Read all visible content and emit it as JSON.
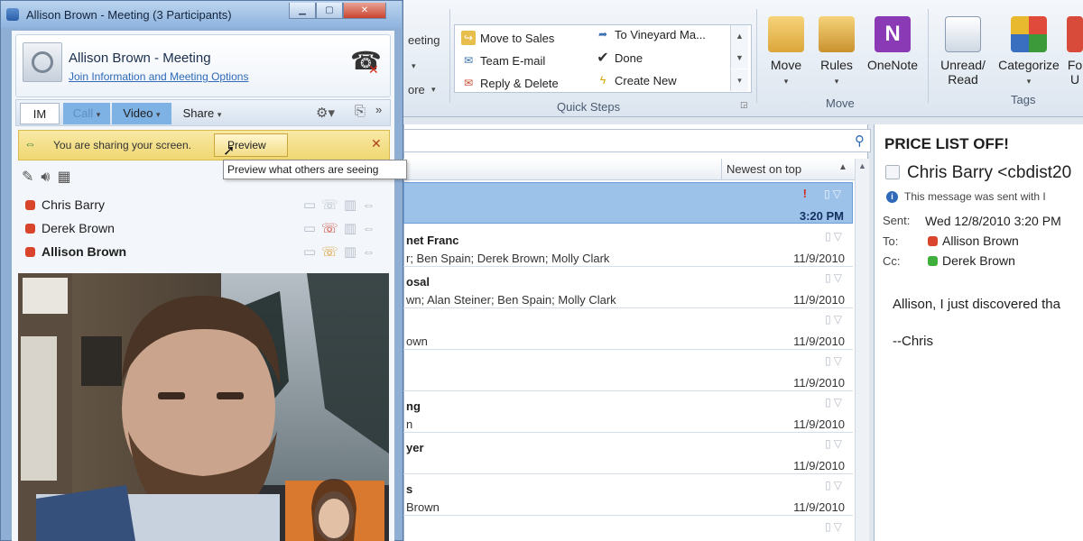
{
  "ribbon": {
    "partial_left": [
      "eeting",
      "ore"
    ],
    "quick_steps": [
      {
        "label": "Move to Sales",
        "icon": "folder-move-icon"
      },
      {
        "label": "Team E-mail",
        "icon": "team-email-icon"
      },
      {
        "label": "Reply & Delete",
        "icon": "reply-delete-icon"
      },
      {
        "label": "To Vineyard Ma...",
        "icon": "forward-icon"
      },
      {
        "label": "Done",
        "icon": "checkmark-icon"
      },
      {
        "label": "Create New",
        "icon": "lightning-icon"
      }
    ],
    "quick_steps_label": "Quick Steps",
    "move_group": {
      "move": "Move",
      "rules": "Rules",
      "onenote": "OneNote",
      "label": "Move"
    },
    "tags_group": {
      "unread_line1": "Unread/",
      "unread_line2": "Read",
      "categorize": "Categorize",
      "follow_partial_1": "Fo",
      "follow_partial_2": "U",
      "label": "Tags"
    }
  },
  "mail_list": {
    "sort_label": "Newest on top",
    "selected_time": "3:20 PM",
    "rows": [
      {
        "sender": "net Franc",
        "recipients": "r;  Ben Spain;  Derek Brown;  Molly Clark",
        "date": "11/9/2010"
      },
      {
        "sender": "osal",
        "recipients": "wn;  Alan Steiner;  Ben Spain;  Molly Clark",
        "date": "11/9/2010"
      },
      {
        "sender": "",
        "recipients": "own",
        "date": "11/9/2010"
      },
      {
        "sender": "",
        "recipients": "",
        "date": "11/9/2010"
      },
      {
        "sender": "ng",
        "recipients": "n",
        "date": "11/9/2010"
      },
      {
        "sender": "yer",
        "recipients": "",
        "date": "11/9/2010"
      },
      {
        "sender": "s",
        "recipients": "Brown",
        "date": "11/9/2010"
      }
    ]
  },
  "reading": {
    "subject": "PRICE LIST OFF!",
    "from": "Chris Barry <cbdist20",
    "info": "This message was sent with I",
    "sent_label": "Sent:",
    "sent_value": "Wed 12/8/2010 3:20 PM",
    "to_label": "To:",
    "to_value": "Allison Brown",
    "cc_label": "Cc:",
    "cc_value": "Derek Brown",
    "body_line1": "Allison, I just discovered tha",
    "body_line2": "--Chris"
  },
  "lync": {
    "window_title": "Allison Brown - Meeting (3 Participants)",
    "meeting_title": "Allison Brown - Meeting",
    "join_link": "Join Information and Meeting Options",
    "modes": {
      "im": "IM",
      "call": "Call",
      "video": "Video",
      "share": "Share"
    },
    "share_notice": "You are sharing your screen.",
    "preview_button": "Preview",
    "tooltip": "Preview what others are seeing",
    "participants": [
      {
        "name": "Chris Barry",
        "bold": false
      },
      {
        "name": "Derek Brown",
        "bold": false
      },
      {
        "name": "Allison Brown",
        "bold": true
      }
    ]
  },
  "colors": {
    "selected_row": "#9cc2ea",
    "share_bar": "#f2dc7c",
    "presence_busy": "#d9442d",
    "presence_available": "#3fae3a",
    "accent": "#2e6ab8"
  }
}
